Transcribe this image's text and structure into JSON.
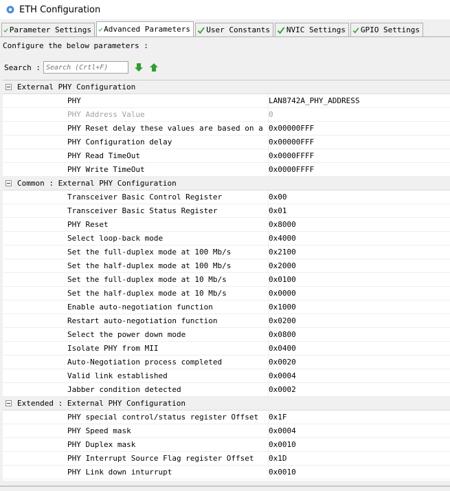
{
  "window": {
    "title": "ETH Configuration",
    "icon": "gear-icon"
  },
  "tabs": [
    {
      "label": "Parameter Settings",
      "active": false
    },
    {
      "label": "Advanced Parameters",
      "active": true
    },
    {
      "label": "User Constants",
      "active": false
    },
    {
      "label": "NVIC Settings",
      "active": false
    },
    {
      "label": "GPIO Settings",
      "active": false
    }
  ],
  "description": "Configure the below parameters :",
  "search": {
    "label": "Search :",
    "placeholder": "Search (Crtl+F)"
  },
  "groups": [
    {
      "title": "External PHY Configuration",
      "rows": [
        {
          "name": "PHY",
          "value": "LAN8742A_PHY_ADDRESS",
          "disabled": false
        },
        {
          "name": "PHY Address Value",
          "value": "0",
          "disabled": true
        },
        {
          "name": "PHY Reset delay these values are based on a 1...",
          "value": "0x00000FFF",
          "disabled": false
        },
        {
          "name": "PHY Configuration delay",
          "value": "0x00000FFF",
          "disabled": false
        },
        {
          "name": "PHY Read TimeOut",
          "value": "0x0000FFFF",
          "disabled": false
        },
        {
          "name": "PHY Write TimeOut",
          "value": "0x0000FFFF",
          "disabled": false
        }
      ]
    },
    {
      "title": "Common : External PHY Configuration",
      "rows": [
        {
          "name": "Transceiver Basic Control Register",
          "value": "0x00",
          "disabled": false
        },
        {
          "name": "Transceiver Basic Status Register",
          "value": "0x01",
          "disabled": false
        },
        {
          "name": "PHY Reset",
          "value": "0x8000",
          "disabled": false
        },
        {
          "name": "Select loop-back mode",
          "value": "0x4000",
          "disabled": false
        },
        {
          "name": "Set the full-duplex mode at 100 Mb/s",
          "value": "0x2100",
          "disabled": false
        },
        {
          "name": "Set the half-duplex mode at 100 Mb/s",
          "value": "0x2000",
          "disabled": false
        },
        {
          "name": "Set the full-duplex mode at 10 Mb/s",
          "value": "0x0100",
          "disabled": false
        },
        {
          "name": "Set the half-duplex mode at 10 Mb/s",
          "value": "0x0000",
          "disabled": false
        },
        {
          "name": "Enable auto-negotiation function",
          "value": "0x1000",
          "disabled": false
        },
        {
          "name": "Restart auto-negotiation function",
          "value": "0x0200",
          "disabled": false
        },
        {
          "name": "Select the power down mode",
          "value": "0x0800",
          "disabled": false
        },
        {
          "name": "Isolate PHY from MII",
          "value": "0x0400",
          "disabled": false
        },
        {
          "name": "Auto-Negotiation process completed",
          "value": "0x0020",
          "disabled": false
        },
        {
          "name": "Valid link established",
          "value": "0x0004",
          "disabled": false
        },
        {
          "name": "Jabber condition detected",
          "value": "0x0002",
          "disabled": false
        }
      ]
    },
    {
      "title": "Extended : External PHY Configuration",
      "rows": [
        {
          "name": "PHY special control/status register Offset",
          "value": "0x1F",
          "disabled": false
        },
        {
          "name": "PHY Speed mask",
          "value": "0x0004",
          "disabled": false
        },
        {
          "name": "PHY Duplex mask",
          "value": "0x0010",
          "disabled": false
        },
        {
          "name": "PHY Interrupt Source Flag register Offset",
          "value": "0x1D",
          "disabled": false
        },
        {
          "name": "PHY Link down inturrupt",
          "value": "0x0010",
          "disabled": false
        }
      ]
    }
  ],
  "colors": {
    "check_green": "#3aa335",
    "arrow_green": "#2e9e2e"
  }
}
